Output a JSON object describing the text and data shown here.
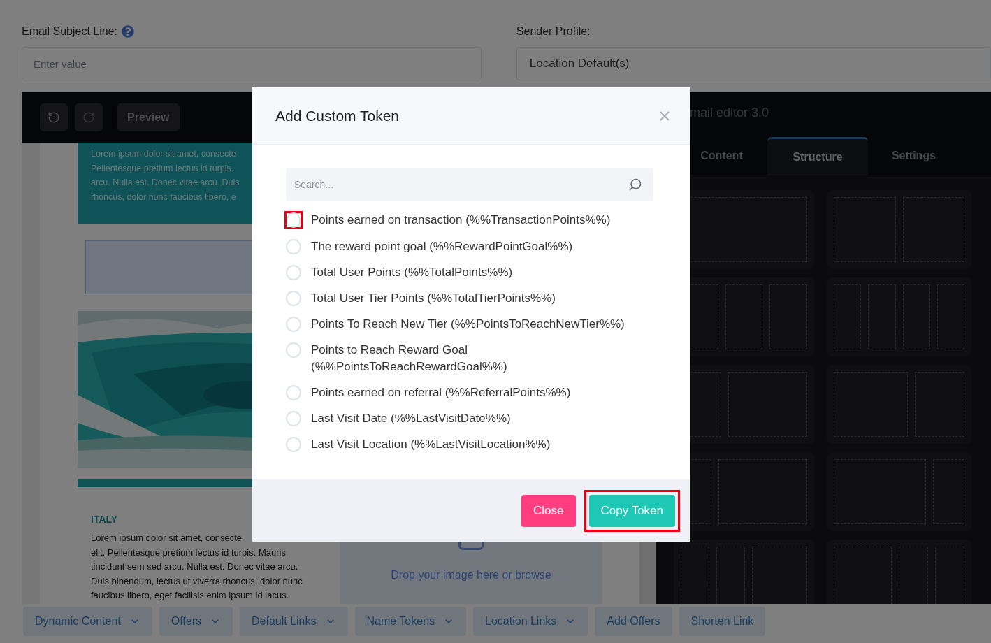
{
  "subject": {
    "label": "Email Subject Line:",
    "placeholder": "Enter value"
  },
  "sender": {
    "label": "Sender Profile:",
    "value": "Location Default(s)"
  },
  "toolbar": {
    "preview": "Preview"
  },
  "editor_panel": {
    "title": "mail editor 3.0",
    "tabs": [
      {
        "label": "Content",
        "selected": false
      },
      {
        "label": "Structure",
        "selected": true
      },
      {
        "label": "Settings",
        "selected": false
      }
    ]
  },
  "email_preview": {
    "banner_lines": [
      "Lorem ipsum dolor sit amet, consecte",
      "Pellentesque pretium lectus id turpis.",
      "arcu. Nulla est. Donec vitae arcu. Duis",
      "rhoncus, dolor nunc faucibus libero, e"
    ],
    "section_heading": "ITALY",
    "section_lines": [
      "Lorem ipsum dolor sit amet, consecte",
      "elit. Pellentesque pretium lectus id turpis. Mauris",
      "tincidunt sem sed arcu. Nulla est. Donec vitae arcu.",
      "Duis bibendum, lectus ut viverra rhoncus, dolor nunc",
      "faucibus libero, eget facilisis enim ipsum id lacus."
    ],
    "dropzone": "Drop your image here or browse"
  },
  "modal": {
    "title": "Add Custom Token",
    "search": {
      "placeholder": "Search..."
    },
    "tokens": [
      {
        "label": "Points earned on transaction (%%TransactionPoints%%)",
        "selected": false,
        "highlighted": true
      },
      {
        "label": "The reward point goal (%%RewardPointGoal%%)",
        "selected": false,
        "highlighted": false
      },
      {
        "label": "Total User Points (%%TotalPoints%%)",
        "selected": false,
        "highlighted": false
      },
      {
        "label": "Total User Tier Points (%%TotalTierPoints%%)",
        "selected": false,
        "highlighted": false
      },
      {
        "label": "Points To Reach New Tier (%%PointsToReachNewTier%%)",
        "selected": false,
        "highlighted": false
      },
      {
        "label": "Points to Reach Reward Goal (%%PointsToReachRewardGoal%%)",
        "selected": false,
        "highlighted": false
      },
      {
        "label": "Points earned on referral (%%ReferralPoints%%)",
        "selected": false,
        "highlighted": false
      },
      {
        "label": "Last Visit Date (%%LastVisitDate%%)",
        "selected": false,
        "highlighted": false
      },
      {
        "label": "Last Visit Location (%%LastVisitLocation%%)",
        "selected": false,
        "highlighted": false
      }
    ],
    "buttons": [
      {
        "label": "Close",
        "kind": "secondary",
        "highlighted": false
      },
      {
        "label": "Copy Token",
        "kind": "primary",
        "highlighted": true
      }
    ]
  },
  "bottom_bar": [
    {
      "label": "Dynamic Content",
      "dropdown": true
    },
    {
      "label": "Offers",
      "dropdown": true
    },
    {
      "label": "Default Links",
      "dropdown": true
    },
    {
      "label": "Name Tokens",
      "dropdown": true
    },
    {
      "label": "Location Links",
      "dropdown": true
    },
    {
      "label": "Add Offers",
      "dropdown": false
    },
    {
      "label": "Shorten Link",
      "dropdown": false
    }
  ]
}
